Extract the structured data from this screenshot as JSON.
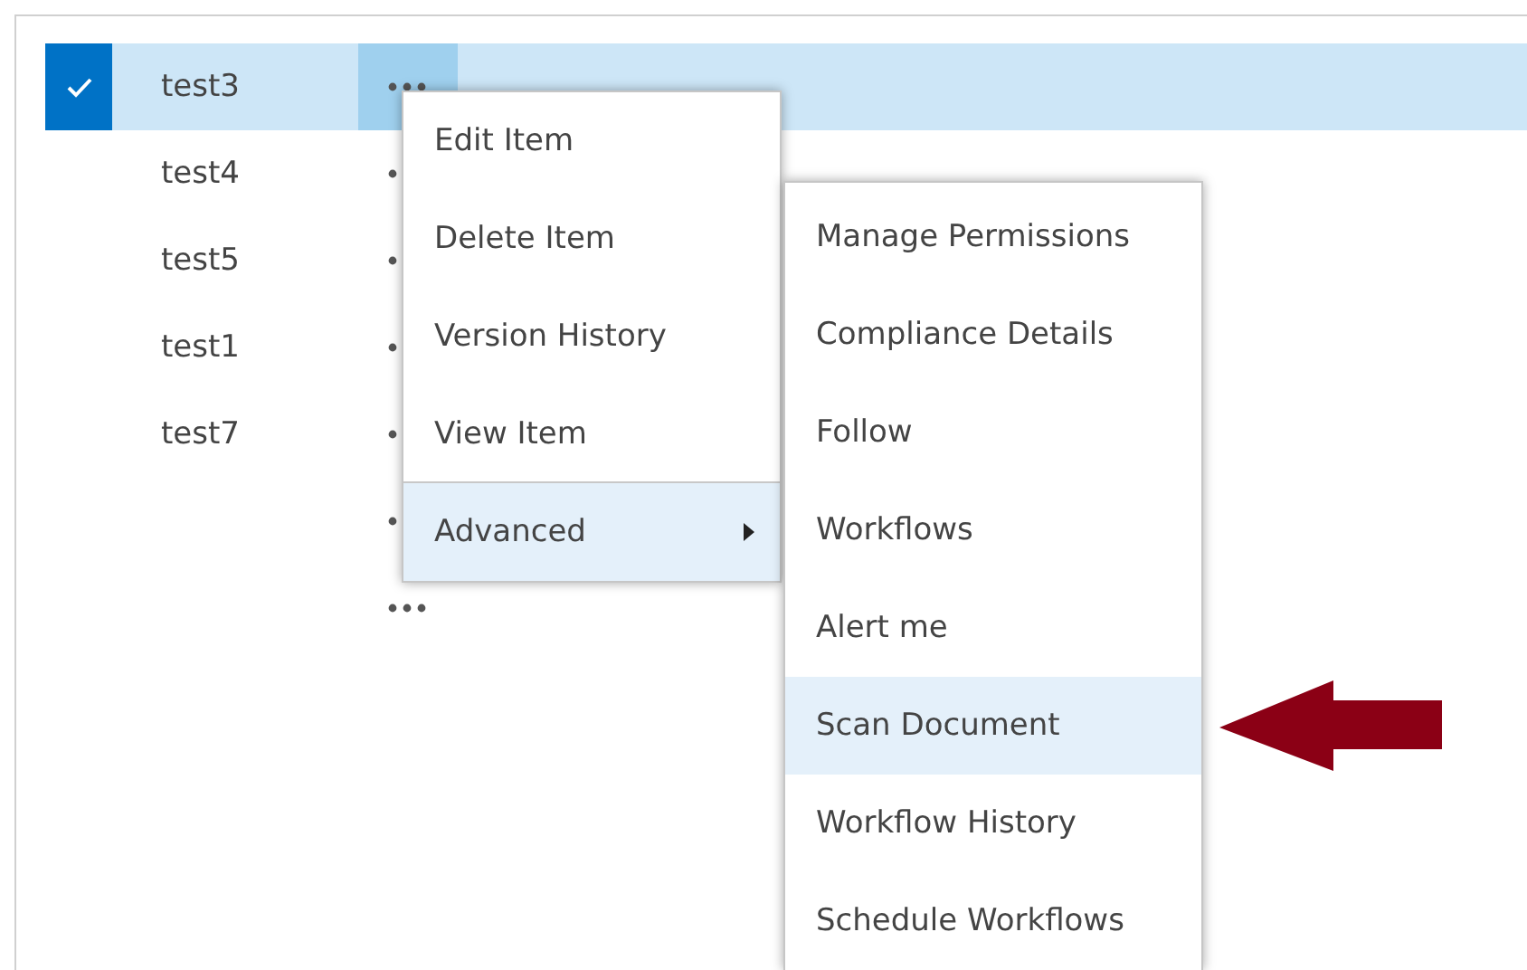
{
  "rows": [
    {
      "name": "test3",
      "selected": true
    },
    {
      "name": "test4",
      "selected": false
    },
    {
      "name": "test5",
      "selected": false
    },
    {
      "name": "test1",
      "selected": false
    },
    {
      "name": "test7",
      "selected": false
    },
    {
      "selected": false
    },
    {
      "selected": false
    }
  ],
  "context_menu": {
    "items": [
      {
        "label": "Edit Item",
        "selected": false,
        "has_submenu": false
      },
      {
        "label": "Delete Item",
        "selected": false,
        "has_submenu": false
      },
      {
        "label": "Version History",
        "selected": false,
        "has_submenu": false
      },
      {
        "label": "View Item",
        "selected": false,
        "has_submenu": false
      },
      {
        "label": "Advanced",
        "selected": true,
        "has_submenu": true
      }
    ]
  },
  "submenu": {
    "items": [
      {
        "label": "Manage Permissions",
        "selected": false
      },
      {
        "label": "Compliance Details",
        "selected": false
      },
      {
        "label": "Follow",
        "selected": false
      },
      {
        "label": "Workflows",
        "selected": false
      },
      {
        "label": "Alert me",
        "selected": false
      },
      {
        "label": "Scan Document",
        "selected": true
      },
      {
        "label": "Workflow History",
        "selected": false
      },
      {
        "label": "Schedule Workflows",
        "selected": false
      }
    ]
  }
}
